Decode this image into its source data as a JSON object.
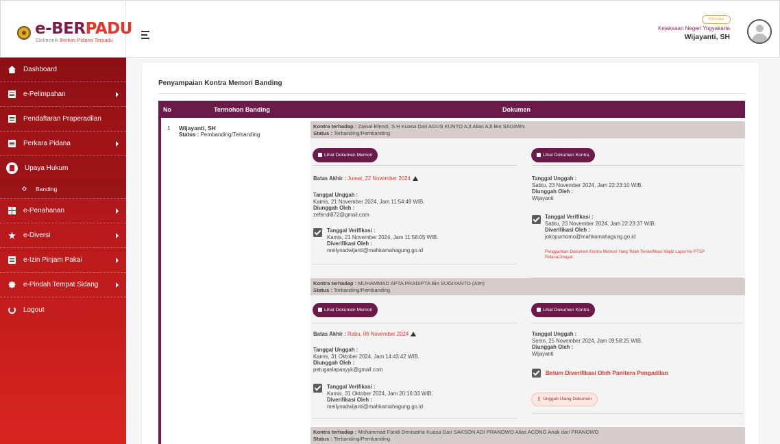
{
  "brand": {
    "title_part1": "e-BER",
    "title_part2": "PADU",
    "subtitle_part1": "Elektronik ",
    "subtitle_part2": "Berkas Pidana Terpadu"
  },
  "user": {
    "role": "Penuntut",
    "instansi": "Kejaksaan Negeri Yogyakarta",
    "name": "Wijayanti, SH"
  },
  "sidebar": {
    "items": [
      {
        "label": "Dashboard",
        "icon": "home-icon",
        "has_caret": false
      },
      {
        "label": "e-Pelimpahan",
        "icon": "document-icon",
        "has_caret": true
      },
      {
        "label": "Pendaftaran Praperadilan",
        "icon": "document-icon",
        "has_caret": false
      },
      {
        "label": "Perkara Pidana",
        "icon": "envelope-icon",
        "has_caret": true
      },
      {
        "label": "Upaya Hukum",
        "icon": "document-icon",
        "has_caret": false,
        "active": true
      },
      {
        "label": "e-Penahanan",
        "icon": "grid-icon",
        "has_caret": true
      },
      {
        "label": "e-Diversi",
        "icon": "star-icon",
        "has_caret": true
      },
      {
        "label": "e-Izin Pinjam Pakai",
        "icon": "envelope-icon",
        "has_caret": true
      },
      {
        "label": "e-Pindah Tempat Sidang",
        "icon": "gear-icon",
        "has_caret": true
      },
      {
        "label": "Logout",
        "icon": "power-icon",
        "has_caret": false
      }
    ],
    "sub_items": [
      {
        "label": "Banding"
      }
    ]
  },
  "main": {
    "page_title": "Penyampaian Kontra Memori Banding",
    "table": {
      "headers": {
        "no": "No",
        "termohon": "Termohon Banding",
        "dokumen": "Dokumen"
      },
      "row": {
        "no": "1",
        "name": "Wijayanti, SH",
        "status_label": "Status :",
        "status_value": " Pembanding/Terbanding"
      }
    },
    "labels": {
      "kontra_terhadap": "Kontra terhadap :",
      "status": "Status :",
      "lihat_memori": "Lihat Dokumen Memori",
      "lihat_kontra": "Lihat Dokumen Kontra",
      "batas_akhir": "Batas Akhir :",
      "tanggal_unggah": "Tanggal Unggah :",
      "diunggah_oleh": "Diunggah Oleh :",
      "tanggal_verifikasi": "Tanggal Verifikasi :",
      "diverifikasi_oleh": "Diverifikasi Oleh :"
    },
    "kontra": [
      {
        "terhadap": " Zainal Efendi, S.H Kuasa Dari AGUS KUNTO AJI Alias AJI Bin SAGIMIN",
        "status": " Terbanding/Pembanding",
        "memori": {
          "batas_akhir": " Jumat, 22 November 2024",
          "tanggal_unggah": "Kamis, 21 November 2024, Jam 11:54:49 WIB.",
          "diunggah_oleh": "zefendi872@gmail.com",
          "tanggal_verifikasi": "Kamis, 21 November 2024, Jam 11:58:05 WIB.",
          "diverifikasi_oleh": "meilynadwijanti@mahkamahagung.go.id"
        },
        "kontra_doc": {
          "tanggal_unggah": "Sabtu, 23 November 2024, Jam 22:23:10 WIB.",
          "diunggah_oleh": "Wijayanti",
          "tanggal_verifikasi": "Sabtu, 23 November 2024, Jam 22:23:37 WIB.",
          "diverifikasi_oleh": "jokopurnomo@mahkamahagung.go.id",
          "note_line1": "Penggantian Dokumen Kontra Memori Yang Telah Terverifikasi Wajib Lapor Ke PTSP",
          "note_line2": "Pidana/Jinayat"
        }
      },
      {
        "terhadap": " MUHAMMAD APTA PRADIPTA Bin SUGIYANTO (Alm)",
        "status": " Terbanding/Pembanding",
        "memori": {
          "batas_akhir": " Rabu, 06 November 2024",
          "tanggal_unggah": "Kamis, 31 Oktober 2024, Jam 14:43:42 WIB.",
          "diunggah_oleh": "petugaslapasyyk@gmail.com",
          "tanggal_verifikasi": "Kamis, 31 Oktober 2024, Jam 20:16:33 WIB.",
          "diverifikasi_oleh": "meilynadwijanti@mahkamahagung.go.id"
        },
        "kontra_doc": {
          "tanggal_unggah": "Senin, 25 November 2024, Jam 09:58:25 WIB.",
          "diunggah_oleh": "Wijayanti",
          "belum_verifikasi": "Belum Diverifikasi Oleh Panitera Pengadilan",
          "unggah_ulang": "Unggah Ulang Dokumen"
        }
      },
      {
        "terhadap": " Mohammad Fandi Denisatria Kuasa Dari SAKSON ADI PRANOWO Alias ACONG Anak dari PRANOWO",
        "status": " Terbanding/Pembanding"
      }
    ]
  }
}
